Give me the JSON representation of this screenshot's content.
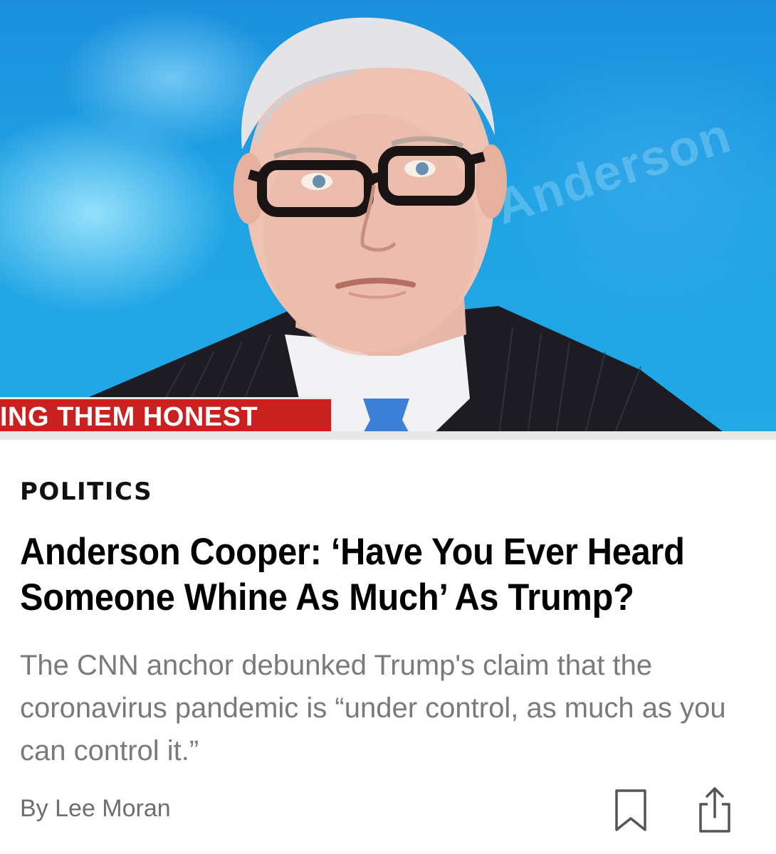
{
  "hero": {
    "chyron_text": "ING THEM HONEST",
    "alt": "Anderson Cooper"
  },
  "article": {
    "category": "POLITICS",
    "headline": "Anderson Cooper: ‘Have You Ever Heard Someone Whine As Much’ As Trump?",
    "subhead": "The CNN anchor debunked Trump's claim that the coronavirus pandemic is “under control, as much as you can control it.”",
    "byline": "By Lee Moran"
  },
  "actions": {
    "bookmark_icon": "bookmark-icon",
    "share_icon": "share-icon"
  },
  "colors": {
    "chyron_red": "#c9211f",
    "studio_blue": "#1ea0e0",
    "subhead_gray": "#7a7a7a"
  }
}
